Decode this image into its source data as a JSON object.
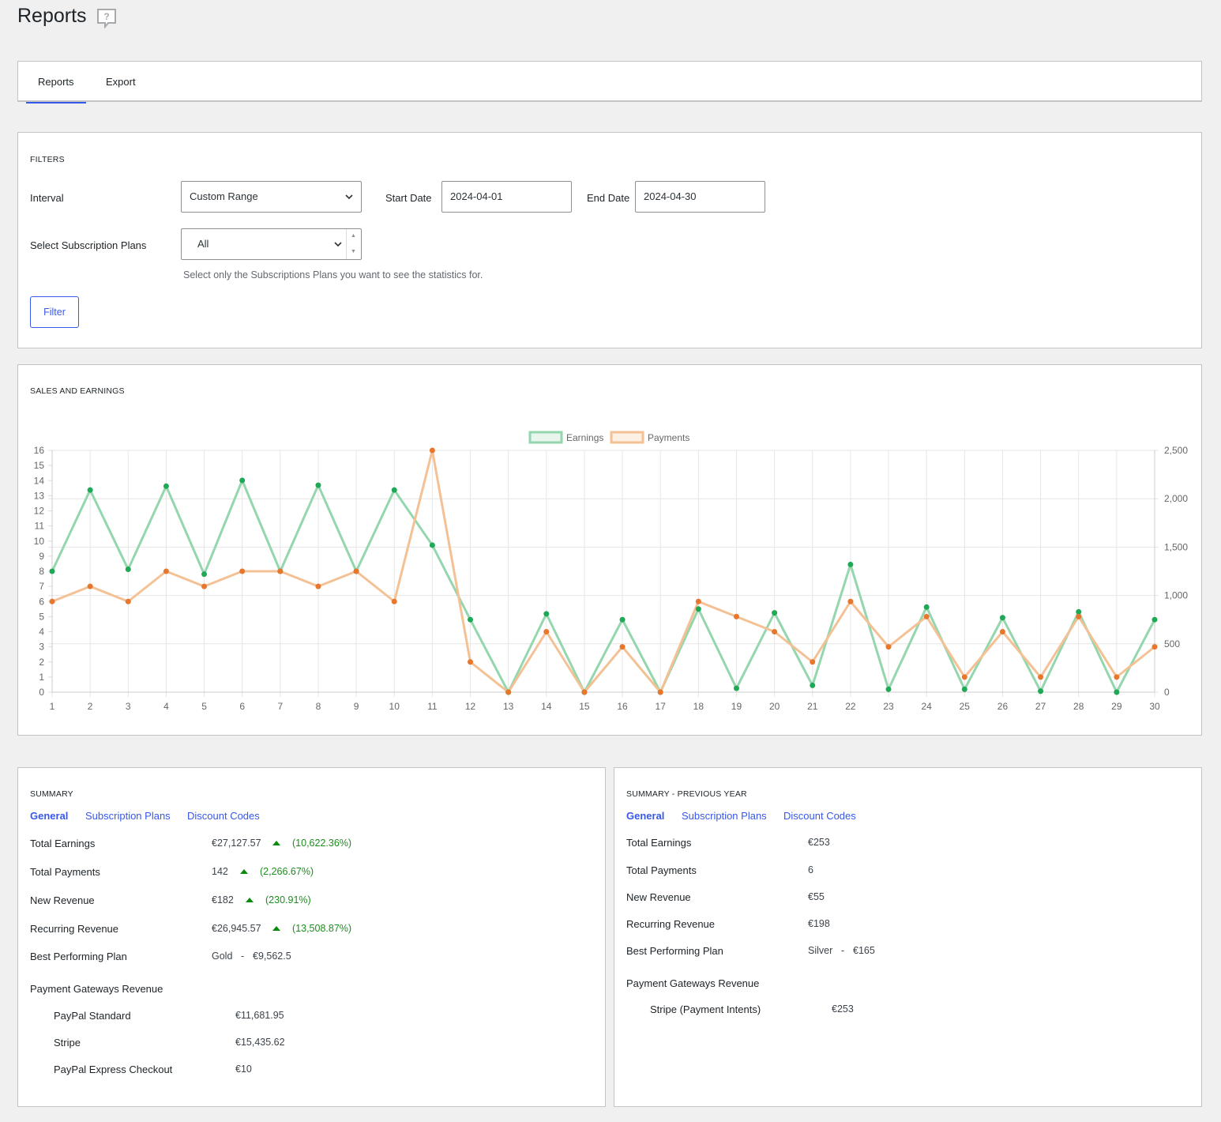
{
  "page": {
    "title": "Reports"
  },
  "tabs": [
    {
      "label": "Reports",
      "active": true
    },
    {
      "label": "Export",
      "active": false
    }
  ],
  "filters": {
    "title": "FILTERS",
    "interval_label": "Interval",
    "interval_value": "Custom Range",
    "start_label": "Start Date",
    "start_value": "2024-04-01",
    "end_label": "End Date",
    "end_value": "2024-04-30",
    "plans_label": "Select Subscription Plans",
    "plans_value": "All",
    "plans_hint": "Select only the Subscriptions Plans you want to see the statistics for.",
    "filter_button": "Filter"
  },
  "chart_title": "SALES AND EARNINGS",
  "chart_data": {
    "type": "line",
    "x": [
      1,
      2,
      3,
      4,
      5,
      6,
      7,
      8,
      9,
      10,
      11,
      12,
      13,
      14,
      15,
      16,
      17,
      18,
      19,
      20,
      21,
      22,
      23,
      24,
      25,
      26,
      27,
      28,
      29,
      30
    ],
    "series": [
      {
        "name": "Earnings",
        "axis": "right",
        "color": "#1fa855",
        "values": [
          1250,
          2090,
          1270,
          2130,
          1220,
          2190,
          1250,
          2140,
          1250,
          2090,
          1520,
          750,
          0,
          810,
          0,
          750,
          0,
          860,
          40,
          820,
          70,
          1320,
          30,
          880,
          30,
          770,
          10,
          830,
          0,
          750
        ]
      },
      {
        "name": "Payments",
        "axis": "left",
        "color": "#e8772e",
        "values": [
          6,
          7,
          6,
          8,
          7,
          8,
          8,
          7,
          8,
          6,
          16,
          2,
          0,
          4,
          0,
          3,
          0,
          6,
          5,
          4,
          2,
          6,
          3,
          5,
          1,
          4,
          1,
          5,
          1,
          3
        ]
      }
    ],
    "y_left": {
      "ticks": [
        "0",
        "1",
        "2",
        "3",
        "4",
        "5",
        "6",
        "7",
        "8",
        "9",
        "10",
        "11",
        "12",
        "13",
        "14",
        "15",
        "16"
      ],
      "ylim": [
        0,
        16
      ]
    },
    "y_right": {
      "ticks": [
        "0",
        "500",
        "1,000",
        "1,500",
        "2,000",
        "2,500"
      ],
      "ylim": [
        0,
        2500
      ]
    },
    "legend": "top-center",
    "grid": true
  },
  "summary": {
    "title": "SUMMARY",
    "tabs": [
      "General",
      "Subscription Plans",
      "Discount Codes"
    ],
    "rows": [
      {
        "label": "Total Earnings",
        "value": "€27,127.57",
        "pct": "(10,622.36%)"
      },
      {
        "label": "Total Payments",
        "value": "142",
        "pct": "(2,266.67%)"
      },
      {
        "label": "New Revenue",
        "value": "€182",
        "pct": "(230.91%)"
      },
      {
        "label": "Recurring Revenue",
        "value": "€26,945.57",
        "pct": "(13,508.87%)"
      }
    ],
    "best_label": "Best Performing Plan",
    "best_plan": "Gold",
    "best_sep": "-",
    "best_value": "€9,562.5",
    "gateways_label": "Payment Gateways Revenue",
    "gateways": [
      {
        "label": "PayPal Standard",
        "value": "€11,681.95"
      },
      {
        "label": "Stripe",
        "value": "€15,435.62"
      },
      {
        "label": "PayPal Express Checkout",
        "value": "€10"
      }
    ]
  },
  "summary_prev": {
    "title": "SUMMARY - PREVIOUS YEAR",
    "tabs": [
      "General",
      "Subscription Plans",
      "Discount Codes"
    ],
    "rows": [
      {
        "label": "Total Earnings",
        "value": "€253"
      },
      {
        "label": "Total Payments",
        "value": "6"
      },
      {
        "label": "New Revenue",
        "value": "€55"
      },
      {
        "label": "Recurring Revenue",
        "value": "€198"
      }
    ],
    "best_label": "Best Performing Plan",
    "best_plan": "Silver",
    "best_sep": "-",
    "best_value": "€165",
    "gateways_label": "Payment Gateways Revenue",
    "gateways": [
      {
        "label": "Stripe (Payment Intents)",
        "value": "€253"
      }
    ]
  }
}
